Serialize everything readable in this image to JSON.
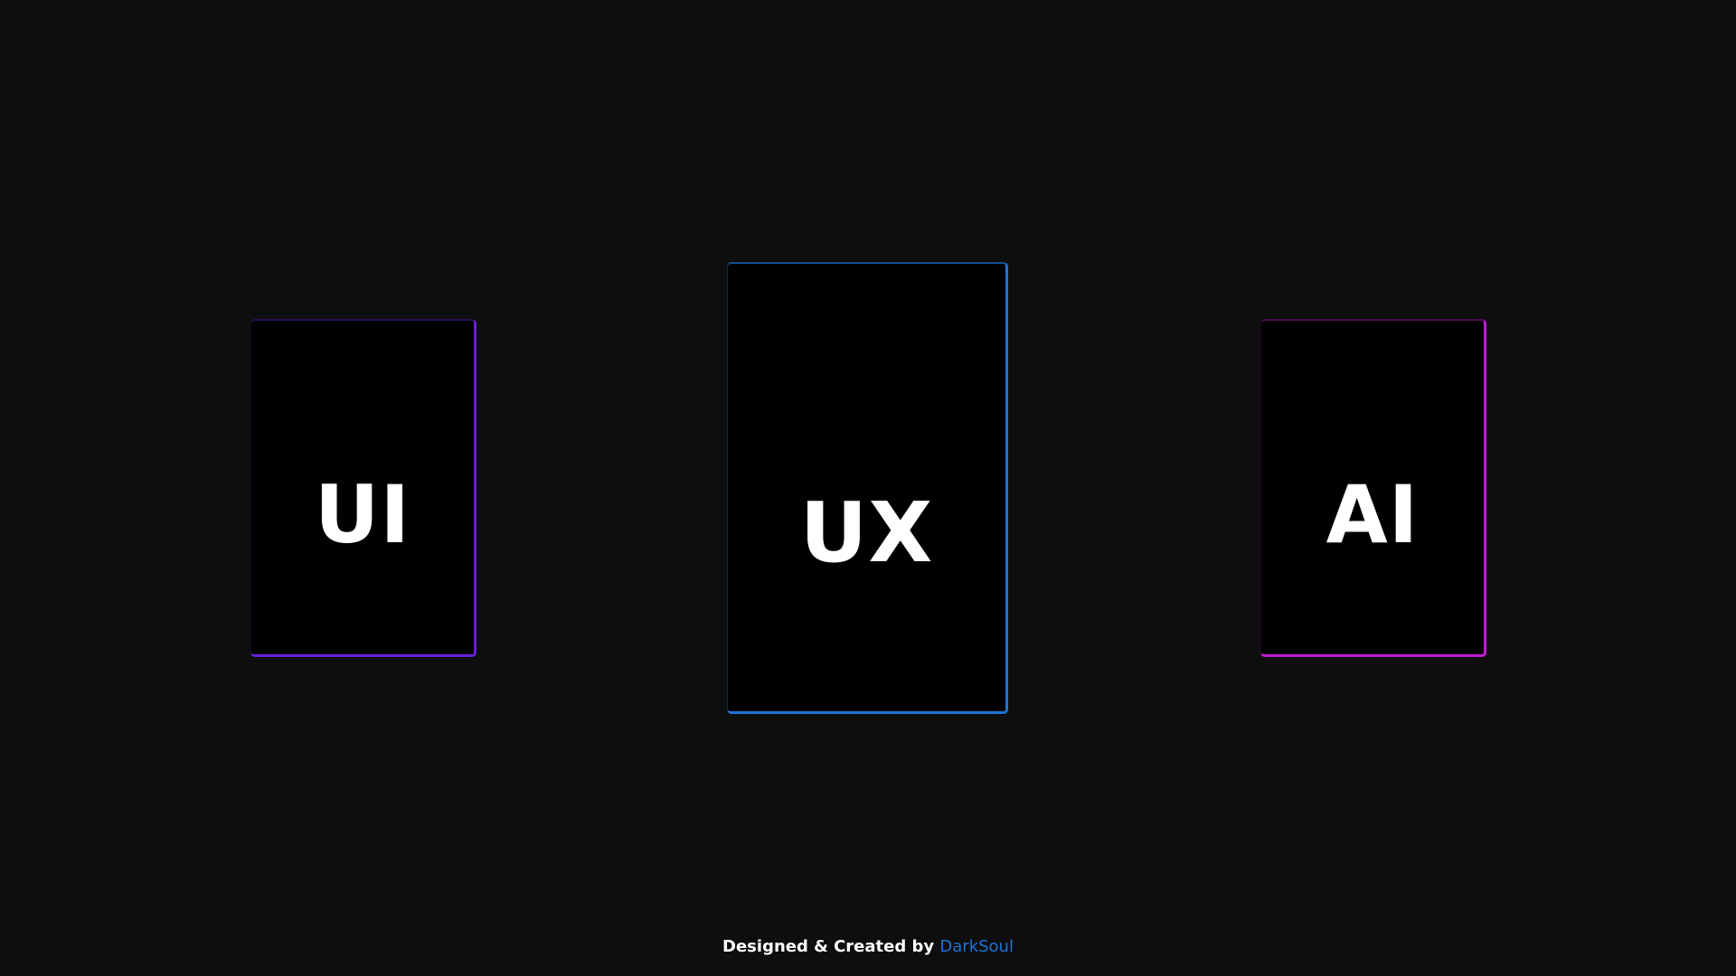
{
  "cards": [
    {
      "label": "UI",
      "accent": "#6a1ed8"
    },
    {
      "label": "UX",
      "accent": "#1f73d6"
    },
    {
      "label": "AI",
      "accent": "#c21ad6"
    }
  ],
  "footer": {
    "text": "Designed & Created by",
    "author": "DarkSoul",
    "author_color": "#1f73d6"
  },
  "colors": {
    "background": "#0e0e0e",
    "card_background": "#000000",
    "text": "#ffffff"
  }
}
